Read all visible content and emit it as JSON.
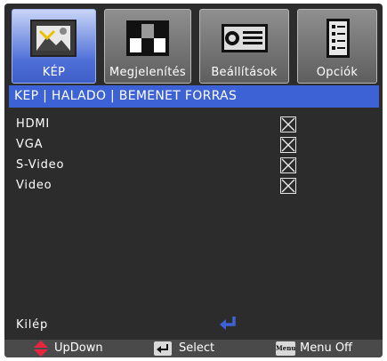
{
  "tabs": [
    {
      "label": "KÉP",
      "icon": "picture-icon",
      "active": true
    },
    {
      "label": "Megjelenítés",
      "icon": "display-icon",
      "active": false
    },
    {
      "label": "Beállítások",
      "icon": "projector-icon",
      "active": false
    },
    {
      "label": "Opciók",
      "icon": "checklist-icon",
      "active": false
    }
  ],
  "header": {
    "title": "KEP | HALADO | BEMENET FORRAS"
  },
  "inputs": [
    {
      "name": "HDMI",
      "checked": true
    },
    {
      "name": "VGA",
      "checked": true
    },
    {
      "name": "S-Video",
      "checked": true
    },
    {
      "name": "Video",
      "checked": true
    }
  ],
  "exit": {
    "label": "Kilép"
  },
  "footer": {
    "updown": "UpDown",
    "select": "Select",
    "menu_key": "Menu",
    "menu_off": "Menu Off"
  },
  "colors": {
    "accent": "#3d62d6",
    "panel": "#2c2c2c",
    "footer": "#4a4a4a",
    "updown_arrows": "#e8253a",
    "enter_icon": "#3d62d6"
  }
}
